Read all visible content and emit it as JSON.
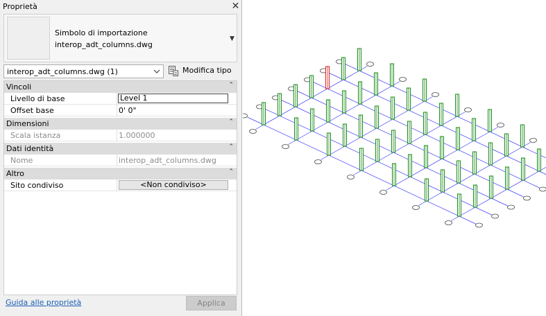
{
  "panel": {
    "title": "Proprietà",
    "close_glyph": "✕",
    "type_selector": {
      "line1": "Simbolo di importazione",
      "line2": "interop_adt_columns.dwg",
      "arrow": "▼"
    },
    "instance_filter": "interop_adt_columns.dwg (1)",
    "edit_type_label": "Modifica tipo",
    "categories": [
      {
        "label": "Vincoli",
        "toggle": "⌃"
      },
      {
        "label": "Dimensioni",
        "toggle": "⌃"
      },
      {
        "label": "Dati identità",
        "toggle": "⌃"
      },
      {
        "label": "Altro",
        "toggle": "⌃"
      }
    ],
    "rows": {
      "livello": {
        "name": "Livello di base",
        "value": "Level 1"
      },
      "offset": {
        "name": "Offset base",
        "value": "0'  0\""
      },
      "scala": {
        "name": "Scala istanza",
        "value": "1.000000"
      },
      "nome": {
        "name": "Nome",
        "value": "interop_adt_columns.dwg"
      },
      "sito": {
        "name": "Sito condiviso",
        "value": "<Non condiviso>"
      }
    },
    "help_link": "Guida alle proprietà",
    "apply_label": "Applica"
  },
  "view": {
    "grid_color": "#3b3bff",
    "column_color": "#1a8c1a",
    "selected_column_color": "#d42020",
    "bubble_color": "#4a4a4a"
  }
}
